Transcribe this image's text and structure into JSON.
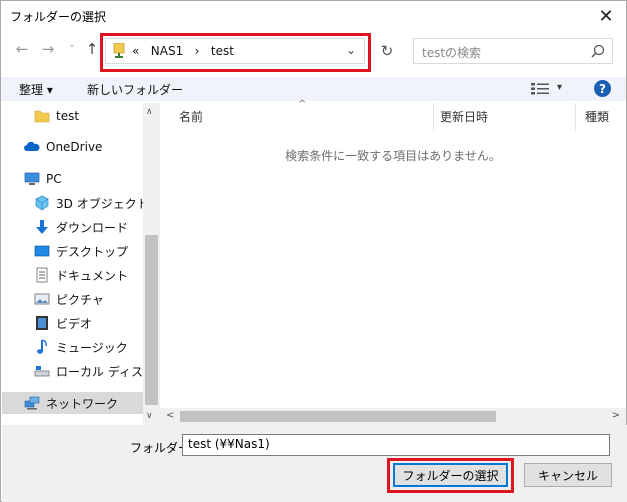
{
  "window": {
    "title": "フォルダーの選択",
    "close_glyph": "✕"
  },
  "nav": {
    "back": "←",
    "forward": "→",
    "recent": "˅",
    "up": "↑",
    "address": "«   NAS1   ›   test",
    "address_chevron": "⌄",
    "refresh": "↻",
    "search_placeholder": "testの検索"
  },
  "toolbar": {
    "organize": "整理 ▾",
    "new_folder": "新しいフォルダー",
    "view_chevron": "▾",
    "help": "?"
  },
  "sidebar": {
    "items": [
      {
        "label": "test",
        "icon": "folder-icon"
      },
      {
        "label": "OneDrive",
        "icon": "cloud-icon"
      },
      {
        "label": "PC",
        "icon": "pc-icon"
      },
      {
        "label": "3D オブジェクト",
        "icon": "3d-objects-icon"
      },
      {
        "label": "ダウンロード",
        "icon": "download-icon"
      },
      {
        "label": "デスクトップ",
        "icon": "desktop-icon"
      },
      {
        "label": "ドキュメント",
        "icon": "document-icon"
      },
      {
        "label": "ピクチャ",
        "icon": "picture-icon"
      },
      {
        "label": "ビデオ",
        "icon": "video-icon"
      },
      {
        "label": "ミュージック",
        "icon": "music-icon"
      },
      {
        "label": "ローカル ディスク (C",
        "icon": "local-disk-icon"
      },
      {
        "label": "ネットワーク",
        "icon": "network-icon"
      }
    ],
    "scroll_up": "∧",
    "scroll_down": "∨"
  },
  "list": {
    "columns": [
      "名前",
      "更新日時",
      "種類"
    ],
    "sort_arrow": "^",
    "empty_message": "検索条件に一致する項目はありません。",
    "scroll_left": "<",
    "scroll_right": ">"
  },
  "footer": {
    "folder_label": "フォルダー:",
    "folder_value": "test (¥¥Nas1)",
    "select_button": "フォルダーの選択",
    "cancel_button": "キャンセル"
  },
  "colors": {
    "highlight": "#e0141e",
    "accent": "#0078d7",
    "help": "#1a5fb4"
  }
}
